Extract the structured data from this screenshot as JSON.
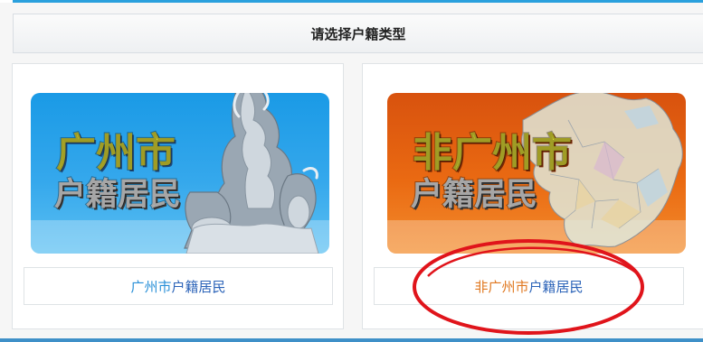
{
  "header": {
    "title": "请选择户籍类型"
  },
  "options": [
    {
      "id": "guangzhou",
      "banner_line1": "广州市",
      "banner_line2": "户籍居民",
      "button_city": "广州市",
      "button_suffix": "户籍居民"
    },
    {
      "id": "non-guangzhou",
      "banner_line1": "非广州市",
      "banner_line2": "户籍居民",
      "button_city": "非广州市",
      "button_suffix": "户籍居民"
    }
  ],
  "colors": {
    "accent": "#2aa0dd",
    "gz_banner": "#1a9ae6",
    "ngz_banner": "#e2620f",
    "annotation_oval": "#e0141b"
  },
  "icons": [
    "goat-statue-image",
    "china-map-image"
  ]
}
